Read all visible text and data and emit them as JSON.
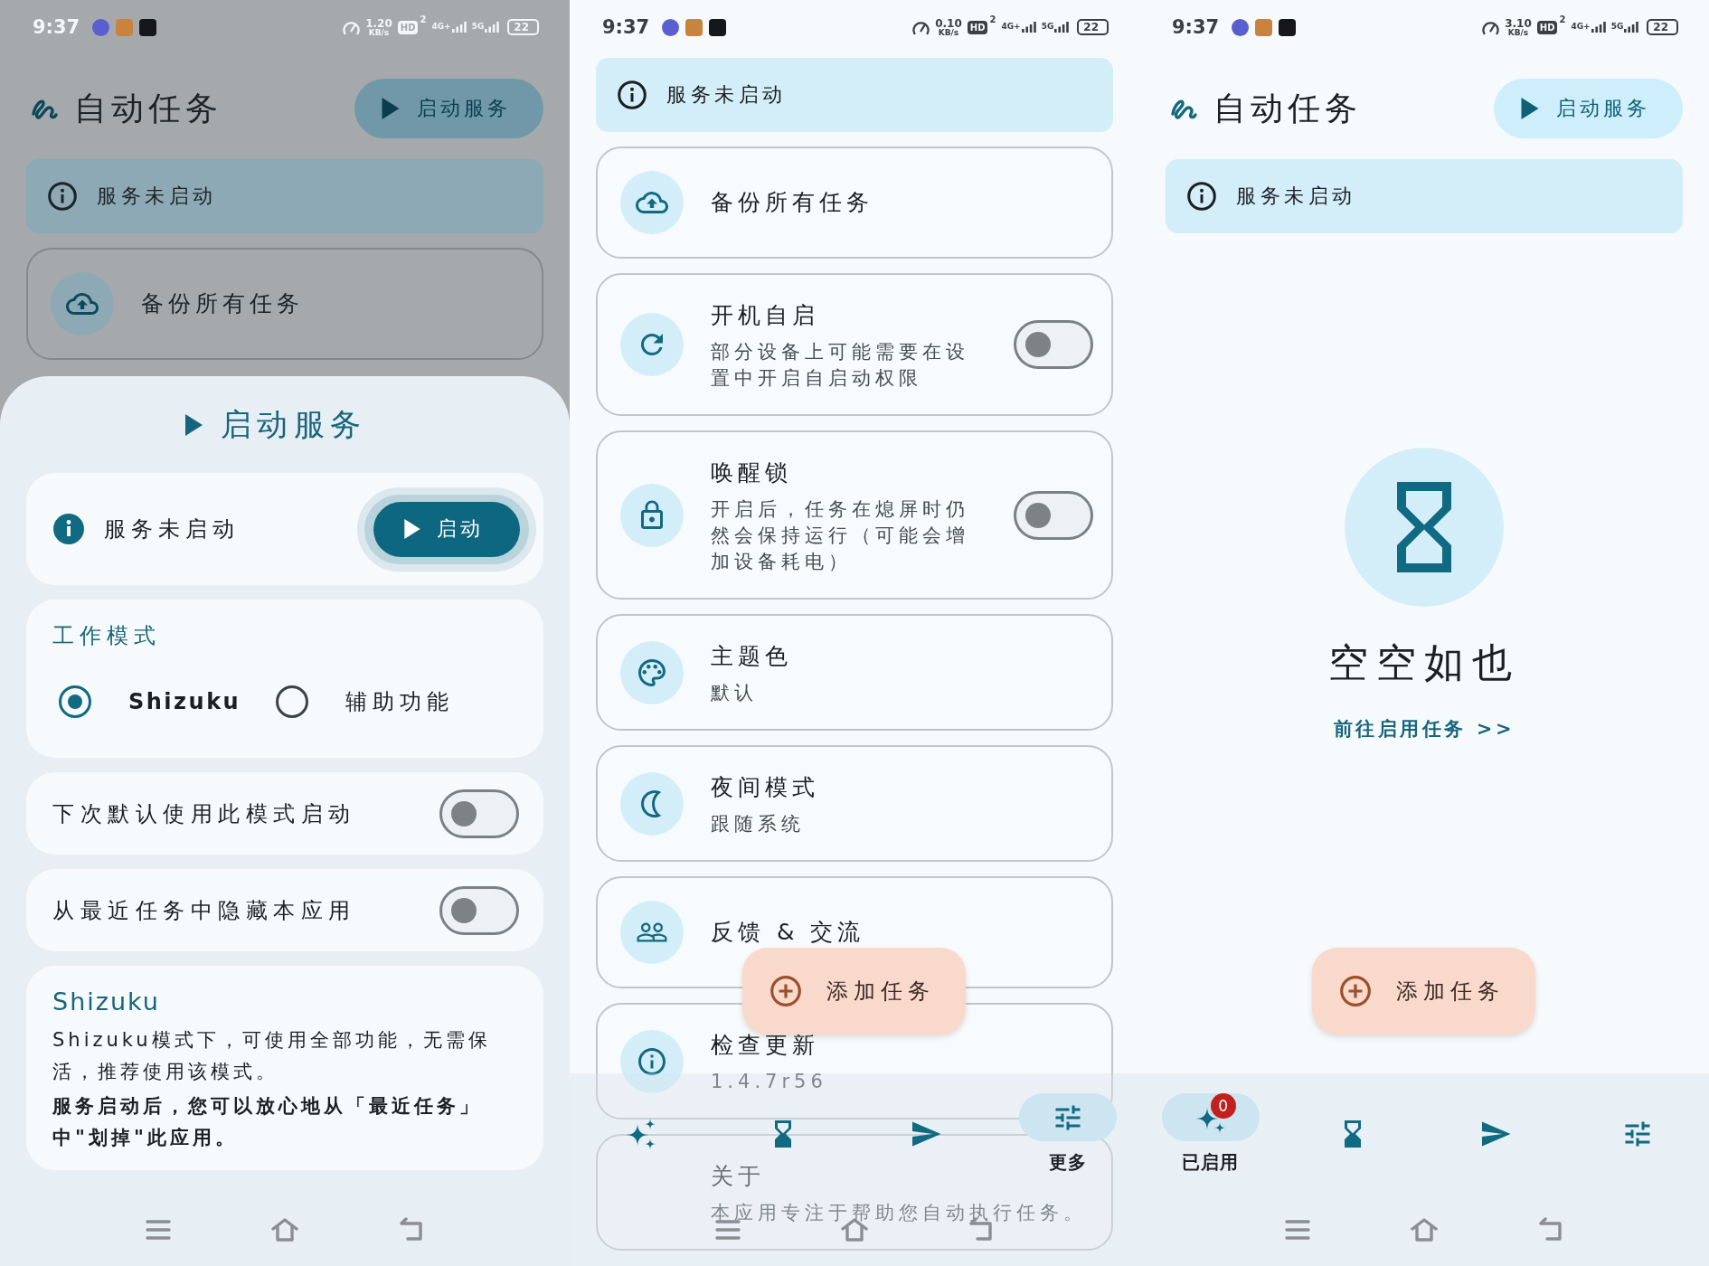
{
  "screens": [
    {
      "status_bar": {
        "time": "9:37",
        "speed": "1.20",
        "speed_unit": "KB/s",
        "hd": "HD",
        "sim": "2",
        "networks": [
          "4G+",
          "5G"
        ],
        "battery": "22"
      },
      "header": {
        "title": "自动任务",
        "action": "启动服务"
      },
      "banner": {
        "text": "服务未启动"
      },
      "settings": [
        {
          "kind": "action",
          "title": "备份所有任务"
        }
      ],
      "bottom_sheet": {
        "title": "启动服务",
        "status": {
          "text": "服务未启动",
          "button": "启动"
        },
        "work_mode": {
          "title": "工作模式",
          "options": [
            {
              "label": "Shizuku",
              "selected": true
            },
            {
              "label": "辅助功能",
              "selected": false
            }
          ]
        },
        "switches": [
          {
            "label": "下次默认使用此模式启动",
            "on": false
          },
          {
            "label": "从最近任务中隐藏本应用",
            "on": false
          }
        ],
        "note": {
          "title": "Shizuku",
          "text": "Shizuku模式下，可使用全部功能，无需保活，推荐使用该模式。",
          "emphasis": "服务启动后，您可以放心地从「最近任务」中\"划掉\"此应用。"
        }
      }
    },
    {
      "status_bar": {
        "time": "9:37",
        "speed": "0.10",
        "speed_unit": "KB/s",
        "hd": "HD",
        "sim": "2",
        "networks": [
          "4G+",
          "5G"
        ],
        "battery": "22"
      },
      "banner": {
        "text": "服务未启动"
      },
      "settings": [
        {
          "kind": "action",
          "title": "备份所有任务"
        },
        {
          "kind": "switch",
          "title": "开机自启",
          "description": "部分设备上可能需要在设置中开启自启动权限",
          "on": false
        },
        {
          "kind": "switch",
          "title": "唤醒锁",
          "description": "开启后，任务在熄屏时仍然会保持运行（可能会增加设备耗电）",
          "on": false
        },
        {
          "kind": "value",
          "title": "主题色",
          "value": "默认"
        },
        {
          "kind": "value",
          "title": "夜间模式",
          "value": "跟随系统"
        },
        {
          "kind": "action",
          "title": "反馈 & 交流"
        },
        {
          "kind": "value",
          "title": "检查更新",
          "value": "1.4.7r56"
        },
        {
          "kind": "value",
          "title": "关于",
          "value": "本应用专注于帮助您自动执行任务。"
        }
      ],
      "fab": {
        "label": "添加任务"
      },
      "nav": [
        {
          "selected": false
        },
        {
          "selected": false
        },
        {
          "selected": false
        },
        {
          "selected": true,
          "label": "更多"
        }
      ]
    },
    {
      "status_bar": {
        "time": "9:37",
        "speed": "3.10",
        "speed_unit": "KB/s",
        "hd": "HD",
        "sim": "2",
        "networks": [
          "4G+",
          "5G"
        ],
        "battery": "22"
      },
      "header": {
        "title": "自动任务",
        "action": "启动服务"
      },
      "banner": {
        "text": "服务未启动"
      },
      "empty_state": {
        "title": "空空如也",
        "link": "前往启用任务 >>"
      },
      "fab": {
        "label": "添加任务"
      },
      "nav": [
        {
          "selected": true,
          "label": "已启用",
          "badge": "0"
        },
        {
          "selected": false
        },
        {
          "selected": false
        },
        {
          "selected": false
        }
      ]
    }
  ]
}
